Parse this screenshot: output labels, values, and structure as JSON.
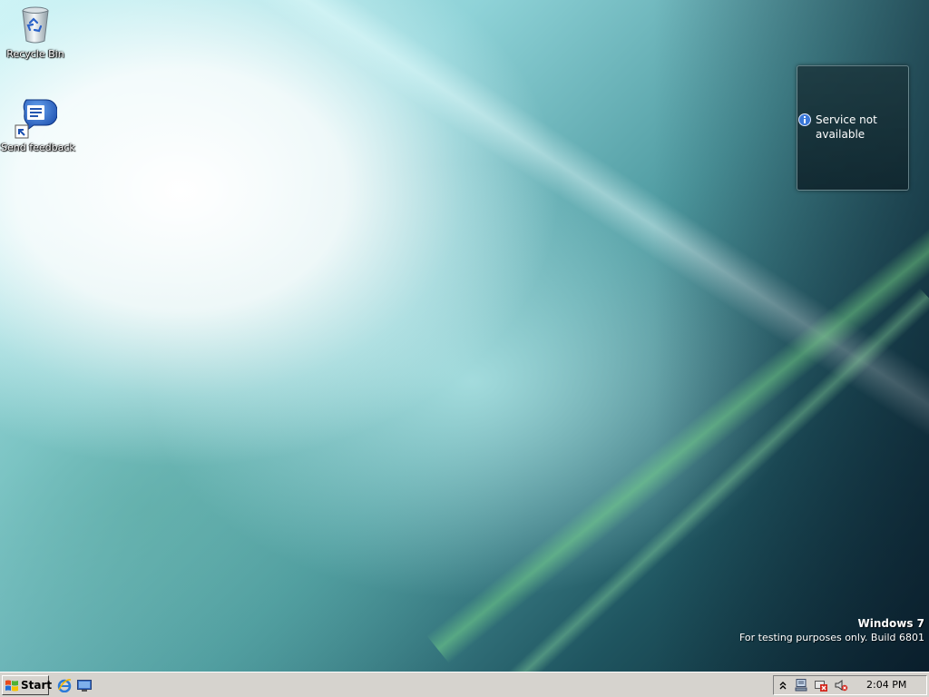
{
  "desktop": {
    "icons": [
      {
        "label": "Recycle Bin",
        "icon": "recycle-bin-icon"
      },
      {
        "label": "Send feedback",
        "icon": "send-feedback-icon"
      }
    ],
    "gadget": {
      "message": "Service not available",
      "icon": "info-icon"
    },
    "watermark": {
      "os": "Windows 7",
      "build": "For testing purposes only. Build 6801"
    }
  },
  "taskbar": {
    "start_label": "Start",
    "quick_launch": [
      {
        "icon": "internet-explorer-icon"
      },
      {
        "icon": "show-desktop-icon"
      }
    ],
    "tray": {
      "icons": [
        "show-hidden-icons-chevron",
        "network-icon",
        "action-center-icon",
        "volume-muted-icon"
      ],
      "clock": "2:04 PM"
    }
  },
  "colors": {
    "taskbar": "#d6d3ce",
    "gadget_bg": "#1c373e",
    "info_blue": "#3a78d8"
  }
}
